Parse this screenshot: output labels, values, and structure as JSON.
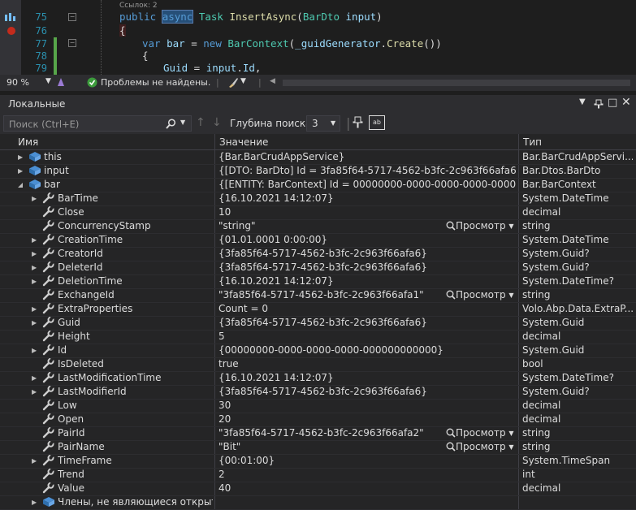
{
  "editor": {
    "refs": "Ссылок: 2",
    "lines": [
      {
        "num": "75"
      },
      {
        "num": "76"
      },
      {
        "num": "77"
      },
      {
        "num": "78"
      },
      {
        "num": "79"
      }
    ],
    "code": {
      "l75_kw": "public",
      "l75_async": "async",
      "l75_task": "Task",
      "l75_fn": "InsertAsync",
      "l75_type": "BarDto",
      "l75_param": "input",
      "l76": "{",
      "l77_var": "var",
      "l77_bar": "bar",
      "l77_new": "new",
      "l77_type": "BarContext",
      "l77_field": "_guidGenerator",
      "l77_create": "Create",
      "l78": "{",
      "l79_prop": "Guid",
      "l79_input": "input",
      "l79_id": "Id"
    },
    "status": {
      "zoom": "90 %",
      "problems": "Проблемы не найдены."
    }
  },
  "locals": {
    "title": "Локальные",
    "search_placeholder": "Поиск (Ctrl+E)",
    "depth_label": "Глубина поиска:",
    "depth_value": "3",
    "columns": {
      "name": "Имя",
      "value": "Значение",
      "type": "Тип"
    },
    "viewer_label": "Просмотр",
    "rows": [
      {
        "indent": 0,
        "expand": true,
        "icon": "object",
        "name": "this",
        "value": "{Bar.BarCrudAppService}",
        "type": "Bar.BarCrudAppServi...",
        "viewer": false
      },
      {
        "indent": 0,
        "expand": true,
        "icon": "object",
        "name": "input",
        "value": "{[DTO: BarDto] Id = 3fa85f64-5717-4562-b3fc-2c963f66afa6}",
        "type": "Bar.Dtos.BarDto",
        "viewer": false
      },
      {
        "indent": 0,
        "expand": true,
        "open": true,
        "icon": "object",
        "name": "bar",
        "value": "{[ENTITY: BarContext] Id = 00000000-0000-0000-0000-000000000000}",
        "type": "Bar.BarContext",
        "viewer": false
      },
      {
        "indent": 1,
        "expand": true,
        "icon": "wrench",
        "name": "BarTime",
        "value": "{16.10.2021 14:12:07}",
        "type": "System.DateTime",
        "viewer": false
      },
      {
        "indent": 1,
        "expand": false,
        "icon": "wrench",
        "name": "Close",
        "value": "10",
        "type": "decimal",
        "viewer": false
      },
      {
        "indent": 1,
        "expand": false,
        "icon": "wrench",
        "name": "ConcurrencyStamp",
        "value": "\"string\"",
        "type": "string",
        "viewer": true
      },
      {
        "indent": 1,
        "expand": true,
        "icon": "wrench",
        "name": "CreationTime",
        "value": "{01.01.0001 0:00:00}",
        "type": "System.DateTime",
        "viewer": false
      },
      {
        "indent": 1,
        "expand": true,
        "icon": "wrench",
        "name": "CreatorId",
        "value": "{3fa85f64-5717-4562-b3fc-2c963f66afa6}",
        "type": "System.Guid?",
        "viewer": false
      },
      {
        "indent": 1,
        "expand": true,
        "icon": "wrench",
        "name": "DeleterId",
        "value": "{3fa85f64-5717-4562-b3fc-2c963f66afa6}",
        "type": "System.Guid?",
        "viewer": false
      },
      {
        "indent": 1,
        "expand": true,
        "icon": "wrench",
        "name": "DeletionTime",
        "value": "{16.10.2021 14:12:07}",
        "type": "System.DateTime?",
        "viewer": false
      },
      {
        "indent": 1,
        "expand": false,
        "icon": "wrench",
        "name": "ExchangeId",
        "value": "\"3fa85f64-5717-4562-b3fc-2c963f66afa1\"",
        "type": "string",
        "viewer": true
      },
      {
        "indent": 1,
        "expand": true,
        "icon": "wrench",
        "name": "ExtraProperties",
        "value": "Count = 0",
        "type": "Volo.Abp.Data.ExtraP...",
        "viewer": false
      },
      {
        "indent": 1,
        "expand": true,
        "icon": "wrench",
        "name": "Guid",
        "value": "{3fa85f64-5717-4562-b3fc-2c963f66afa6}",
        "type": "System.Guid",
        "viewer": false
      },
      {
        "indent": 1,
        "expand": false,
        "icon": "wrench",
        "name": "Height",
        "value": "5",
        "type": "decimal",
        "viewer": false
      },
      {
        "indent": 1,
        "expand": true,
        "icon": "wrench",
        "name": "Id",
        "value": "{00000000-0000-0000-0000-000000000000}",
        "type": "System.Guid",
        "viewer": false
      },
      {
        "indent": 1,
        "expand": false,
        "icon": "wrench",
        "name": "IsDeleted",
        "value": "true",
        "type": "bool",
        "viewer": false
      },
      {
        "indent": 1,
        "expand": true,
        "icon": "wrench",
        "name": "LastModificationTime",
        "value": "{16.10.2021 14:12:07}",
        "type": "System.DateTime?",
        "viewer": false
      },
      {
        "indent": 1,
        "expand": true,
        "icon": "wrench",
        "name": "LastModifierId",
        "value": "{3fa85f64-5717-4562-b3fc-2c963f66afa6}",
        "type": "System.Guid?",
        "viewer": false
      },
      {
        "indent": 1,
        "expand": false,
        "icon": "wrench",
        "name": "Low",
        "value": "30",
        "type": "decimal",
        "viewer": false
      },
      {
        "indent": 1,
        "expand": false,
        "icon": "wrench",
        "name": "Open",
        "value": "20",
        "type": "decimal",
        "viewer": false
      },
      {
        "indent": 1,
        "expand": false,
        "icon": "wrench",
        "name": "PairId",
        "value": "\"3fa85f64-5717-4562-b3fc-2c963f66afa2\"",
        "type": "string",
        "viewer": true
      },
      {
        "indent": 1,
        "expand": false,
        "icon": "wrench",
        "name": "PairName",
        "value": "\"Bit\"",
        "type": "string",
        "viewer": true
      },
      {
        "indent": 1,
        "expand": true,
        "icon": "wrench",
        "name": "TimeFrame",
        "value": "{00:01:00}",
        "type": "System.TimeSpan",
        "viewer": false
      },
      {
        "indent": 1,
        "expand": false,
        "icon": "wrench",
        "name": "Trend",
        "value": "2",
        "type": "int",
        "viewer": false
      },
      {
        "indent": 1,
        "expand": false,
        "icon": "wrench",
        "name": "Value",
        "value": "40",
        "type": "decimal",
        "viewer": false
      },
      {
        "indent": 1,
        "expand": true,
        "icon": "object",
        "name": "Члены, не являющиеся открыты...",
        "value": "",
        "type": "",
        "viewer": false
      }
    ]
  }
}
